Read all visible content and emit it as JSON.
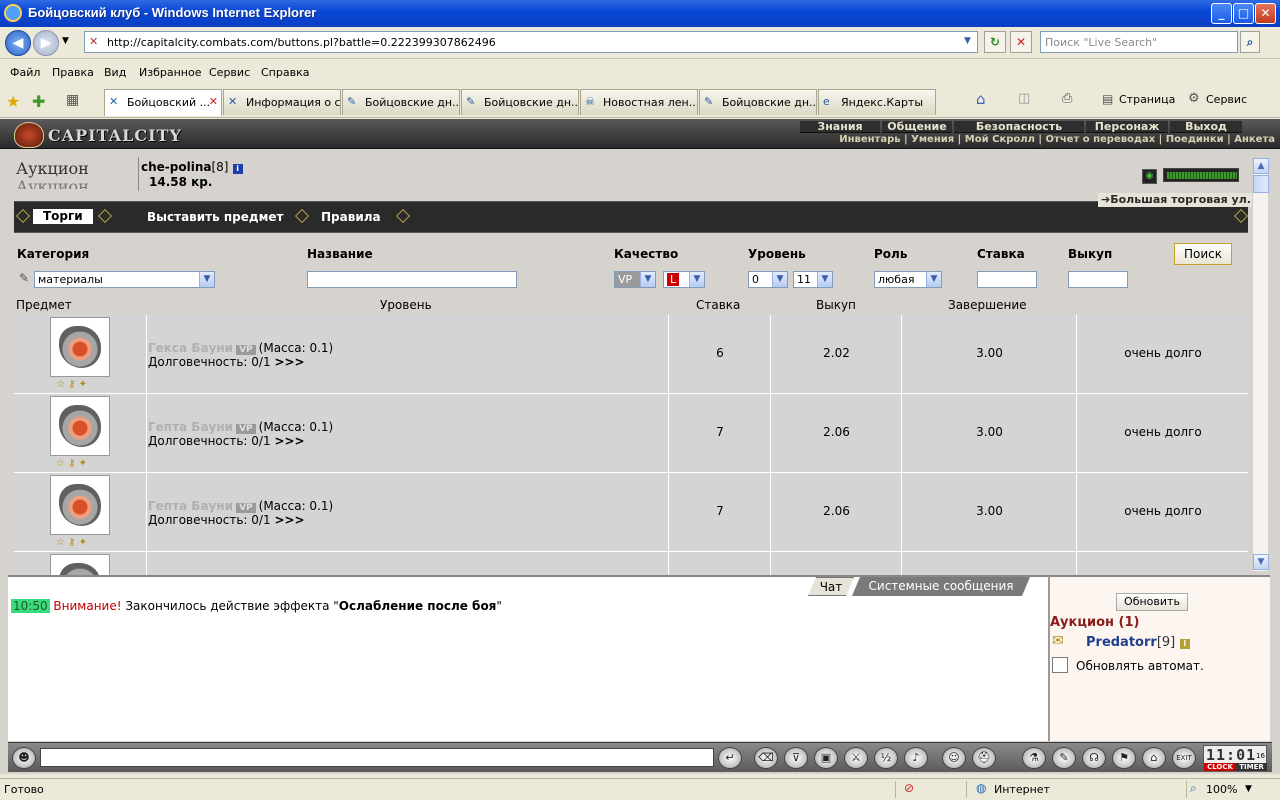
{
  "window": {
    "title": "Бойцовский клуб - Windows Internet Explorer",
    "controls": {
      "minimize": "_",
      "maximize": "□",
      "close": "✕"
    }
  },
  "address": {
    "url": "http://capitalcity.combats.com/buttons.pl?battle=0.222399307862496",
    "search_placeholder": "Поиск \"Live Search\""
  },
  "menu": [
    "Файл",
    "Правка",
    "Вид",
    "Избранное",
    "Сервис",
    "Справка"
  ],
  "tabs": [
    {
      "label": "Бойцовский ...",
      "active": true
    },
    {
      "label": "Информация о с...",
      "active": false
    },
    {
      "label": "Бойцовские дн...",
      "active": false
    },
    {
      "label": "Бойцовские дн...",
      "active": false
    },
    {
      "label": "Новостная лен...",
      "active": false
    },
    {
      "label": "Бойцовские дн...",
      "active": false
    },
    {
      "label": "Яндекс.Карты",
      "active": false
    }
  ],
  "commandbar": {
    "page": "Страница",
    "tools": "Сервис"
  },
  "game": {
    "logo_text": "CAPITALCITY",
    "top_menu": [
      "Знания",
      "Общение",
      "Безопасность",
      "Персонаж",
      "Выход"
    ],
    "sub_menu": "Инвентарь | Умения | Мой Скролл | Отчет о переводах | Поединки | Анкета",
    "page_title": "Аукцион",
    "user": {
      "name": "che-polina",
      "level": "[8]",
      "money": "14.58 кр."
    },
    "hp_fill": 1.0,
    "nav": {
      "trade": "Торги",
      "put_item": "Выставить предмет",
      "rules": "Правила"
    },
    "big_trade": "Большая торговая ул.",
    "filters": {
      "category_label": "Категория",
      "category_value": "материалы",
      "name_label": "Название",
      "quality_label": "Качество",
      "quality_a": "VP",
      "quality_b": "L",
      "level_label": "Уровень",
      "level_from": "0",
      "level_to": "11",
      "role_label": "Роль",
      "role_value": "любая",
      "bid_label": "Ставка",
      "buyout_label": "Выкуп",
      "search_button": "Поиск"
    },
    "table": {
      "headers": {
        "item": "Предмет",
        "level": "Уровень",
        "bid": "Ставка",
        "buyout": "Выкуп",
        "end": "Завершение"
      },
      "rows": [
        {
          "name": "Гекса Бауни",
          "badge": "VP",
          "mass": "(Масса: 0.1)",
          "dur": "Долговечность: 0/1",
          "more": ">>>",
          "level": "6",
          "bid": "2.02",
          "buyout": "3.00",
          "end": "очень долго"
        },
        {
          "name": "Гепта Бауни",
          "badge": "VP",
          "mass": "(Масса: 0.1)",
          "dur": "Долговечность: 0/1",
          "more": ">>>",
          "level": "7",
          "bid": "2.06",
          "buyout": "3.00",
          "end": "очень долго"
        },
        {
          "name": "Гепта Бауни",
          "badge": "VP",
          "mass": "(Масса: 0.1)",
          "dur": "Долговечность: 0/1",
          "more": ">>>",
          "level": "7",
          "bid": "2.06",
          "buyout": "3.00",
          "end": "очень долго"
        }
      ]
    },
    "chat": {
      "tabs": {
        "chat": "Чат",
        "system": "Системные сообщения"
      },
      "message": {
        "time": "10:50",
        "warning": "Внимание!",
        "text": " Закончилось действие эффекта \"",
        "effect": "Ослабление после боя",
        "tail": "\""
      }
    },
    "side": {
      "refresh": "Обновить",
      "title": "Аукцион (1)",
      "player": "Predatorr",
      "player_level": "[9]",
      "auto_refresh": "Обновлять автомат."
    },
    "clock": {
      "time": "11:01",
      "sec": "16",
      "label1": "CLOCK",
      "label2": "TIMER"
    }
  },
  "status": {
    "left": "Готово",
    "zone": "Интернет",
    "zoom": "100%"
  }
}
